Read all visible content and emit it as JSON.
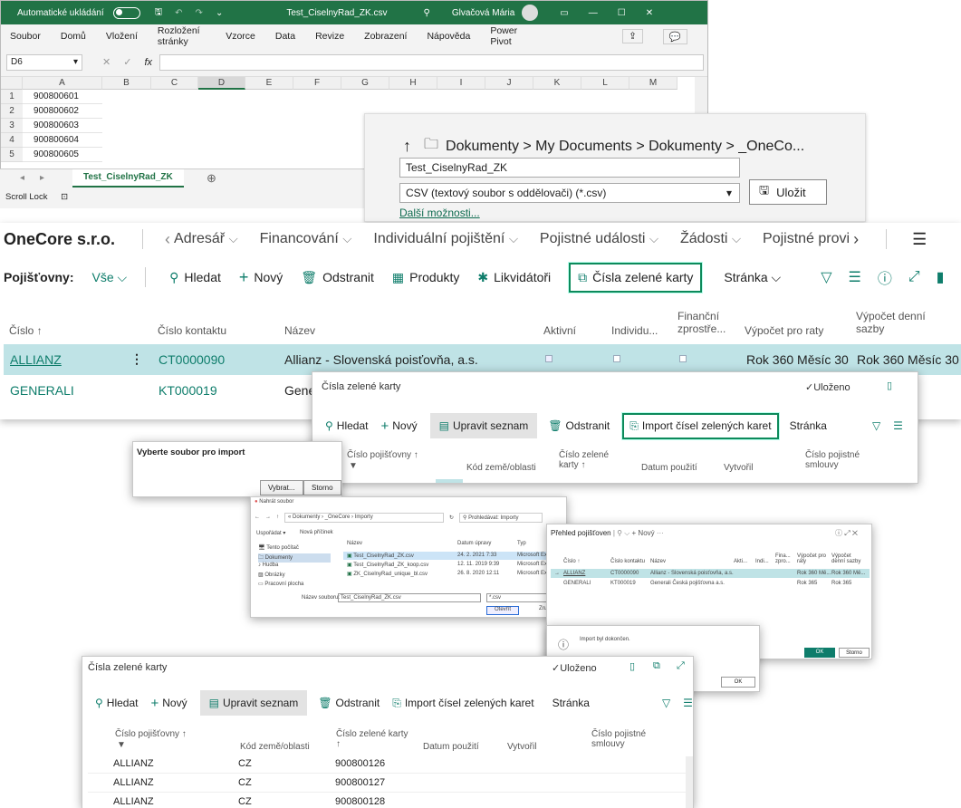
{
  "excel": {
    "autosave_label": "Automatické ukládání",
    "filename": "Test_CiselnyRad_ZK.csv",
    "user": "Glvačová Mária",
    "menu": [
      "Soubor",
      "Domů",
      "Vložení",
      "Rozložení stránky",
      "Vzorce",
      "Data",
      "Revize",
      "Zobrazení",
      "Nápověda",
      "Power Pivot"
    ],
    "namebox": "D6",
    "fx": "fx",
    "columns": [
      "A",
      "B",
      "C",
      "D",
      "E",
      "F",
      "G",
      "H",
      "I",
      "J",
      "K",
      "L",
      "M"
    ],
    "rows": [
      "1",
      "2",
      "3",
      "4",
      "5"
    ],
    "values": [
      "900800601",
      "900800602",
      "900800603",
      "900800604",
      "900800605"
    ],
    "sheet_tab": "Test_CiselnyRad_ZK",
    "status": "Scroll Lock"
  },
  "save_dialog": {
    "path": "Dokumenty > My Documents > Dokumenty > _OneCo...",
    "filename": "Test_CiselnyRad_ZK",
    "filetype": "CSV (textový soubor s oddělovači) (*.csv)",
    "save_label": "Uložit",
    "more_options": "Další možnosti..."
  },
  "bc": {
    "company": "OneCore s.r.o.",
    "nav": [
      "Adresář",
      "Financování",
      "Individuální pojištění",
      "Pojistné události",
      "Žádosti",
      "Pojistné provi"
    ],
    "page_label": "Pojišťovny:",
    "filter_label": "Vše",
    "actions": [
      "Hledat",
      "Nový",
      "Odstranit",
      "Produkty",
      "Likvidátoři",
      "Čísla zelené karty",
      "Stránka"
    ],
    "columns": [
      "Číslo ↑",
      "Číslo kontaktu",
      "Název",
      "Aktivní",
      "Individu...",
      "Finanční zprostře...",
      "Výpočet pro raty",
      "Výpočet denní sazby"
    ],
    "rows": [
      {
        "code": "ALLIANZ",
        "contact": "CT0000090",
        "name": "Allianz - Slovenská poisťovňa, a.s.",
        "rate": "Rok 360 Měsíc 30",
        "daily": "Rok 360 Měsíc 30"
      },
      {
        "code": "GENERALI",
        "contact": "KT000019",
        "name": "Gene"
      }
    ]
  },
  "green_cards_popup": {
    "title": "Čísla zelené karty",
    "saved": "Uloženo",
    "actions": [
      "Hledat",
      "Nový",
      "Upravit seznam",
      "Odstranit",
      "Import čísel zelených karet",
      "Stránka"
    ],
    "columns": [
      "Číslo pojišťovny ↑",
      "Kód země/oblasti",
      "Číslo zelené karty ↑",
      "Datum použití",
      "Vytvořil",
      "Číslo pojistné smlouvy"
    ]
  },
  "select_file": {
    "title": "Vyberte soubor pro import",
    "choose": "Vybrat...",
    "cancel": "Storno"
  },
  "file_dialog": {
    "title": "Nahrát soubor",
    "path": "« Dokumenty › _OneCore › Importy",
    "search": "Prohledávat: Importy",
    "organize": "Uspořádat ▾",
    "new_folder": "Nová příčinek",
    "tree": [
      "Tento počítač",
      "Dokumenty",
      "Hudba",
      "Obrázky",
      "Pracovní plocha"
    ],
    "headers": [
      "Název",
      "Datum úpravy",
      "Typ"
    ],
    "files": [
      {
        "name": "Test_CiselnyRad_ZK.csv",
        "date": "24. 2. 2021 7:33",
        "type": "Microsoft Ex"
      },
      {
        "name": "Test_CiselnyRad_ZK_koop.csv",
        "date": "12. 11. 2019 9:39",
        "type": "Microsoft Ex"
      },
      {
        "name": "ZK_CiselnyRad_unique_bl.csv",
        "date": "26. 8. 2020 12:11",
        "type": "Microsoft Ex"
      }
    ],
    "filename_label": "Název souboru:",
    "filename": "Test_CiselnyRad_ZK.csv",
    "filter": "*.csv",
    "open": "Otevřít",
    "cancel": "Zru"
  },
  "overview": {
    "title": "Přehled pojišťoven",
    "new": "+ Nový",
    "columns": [
      "Číslo ↑",
      "Číslo kontaktu",
      "Název",
      "Akti...",
      "Indi...",
      "Fina... zpro...",
      "Výpočet pro raty",
      "Výpočet denní sazby"
    ],
    "rows": [
      {
        "code": "ALLIANZ",
        "contact": "CT0000090",
        "name": "Allianz - Slovenská poisťovňa, a.s.",
        "rate": "Rok 360 Mě...",
        "daily": "Rok 360 Mě..."
      },
      {
        "code": "GENERALI",
        "contact": "KT000019",
        "name": "Generali Česká pojišťovna a.s.",
        "rate": "Rok 365",
        "daily": "Rok 365"
      }
    ],
    "ok": "OK",
    "cancel": "Storno"
  },
  "import_done": {
    "message": "Import byl dokončen.",
    "ok": "OK"
  },
  "green_cards_result": {
    "title": "Čísla zelené karty",
    "saved": "Uloženo",
    "actions": [
      "Hledat",
      "Nový",
      "Upravit seznam",
      "Odstranit",
      "Import čísel zelených karet",
      "Stránka"
    ],
    "columns": [
      "Číslo pojišťovny ↑",
      "Kód země/oblasti",
      "Číslo zelené karty ↑",
      "Datum použití",
      "Vytvořil",
      "Číslo pojistné smlouvy"
    ],
    "rows": [
      {
        "ins": "ALLIANZ",
        "country": "CZ",
        "card": "900800126"
      },
      {
        "ins": "ALLIANZ",
        "country": "CZ",
        "card": "900800127"
      },
      {
        "ins": "ALLIANZ",
        "country": "CZ",
        "card": "900800128"
      }
    ]
  }
}
